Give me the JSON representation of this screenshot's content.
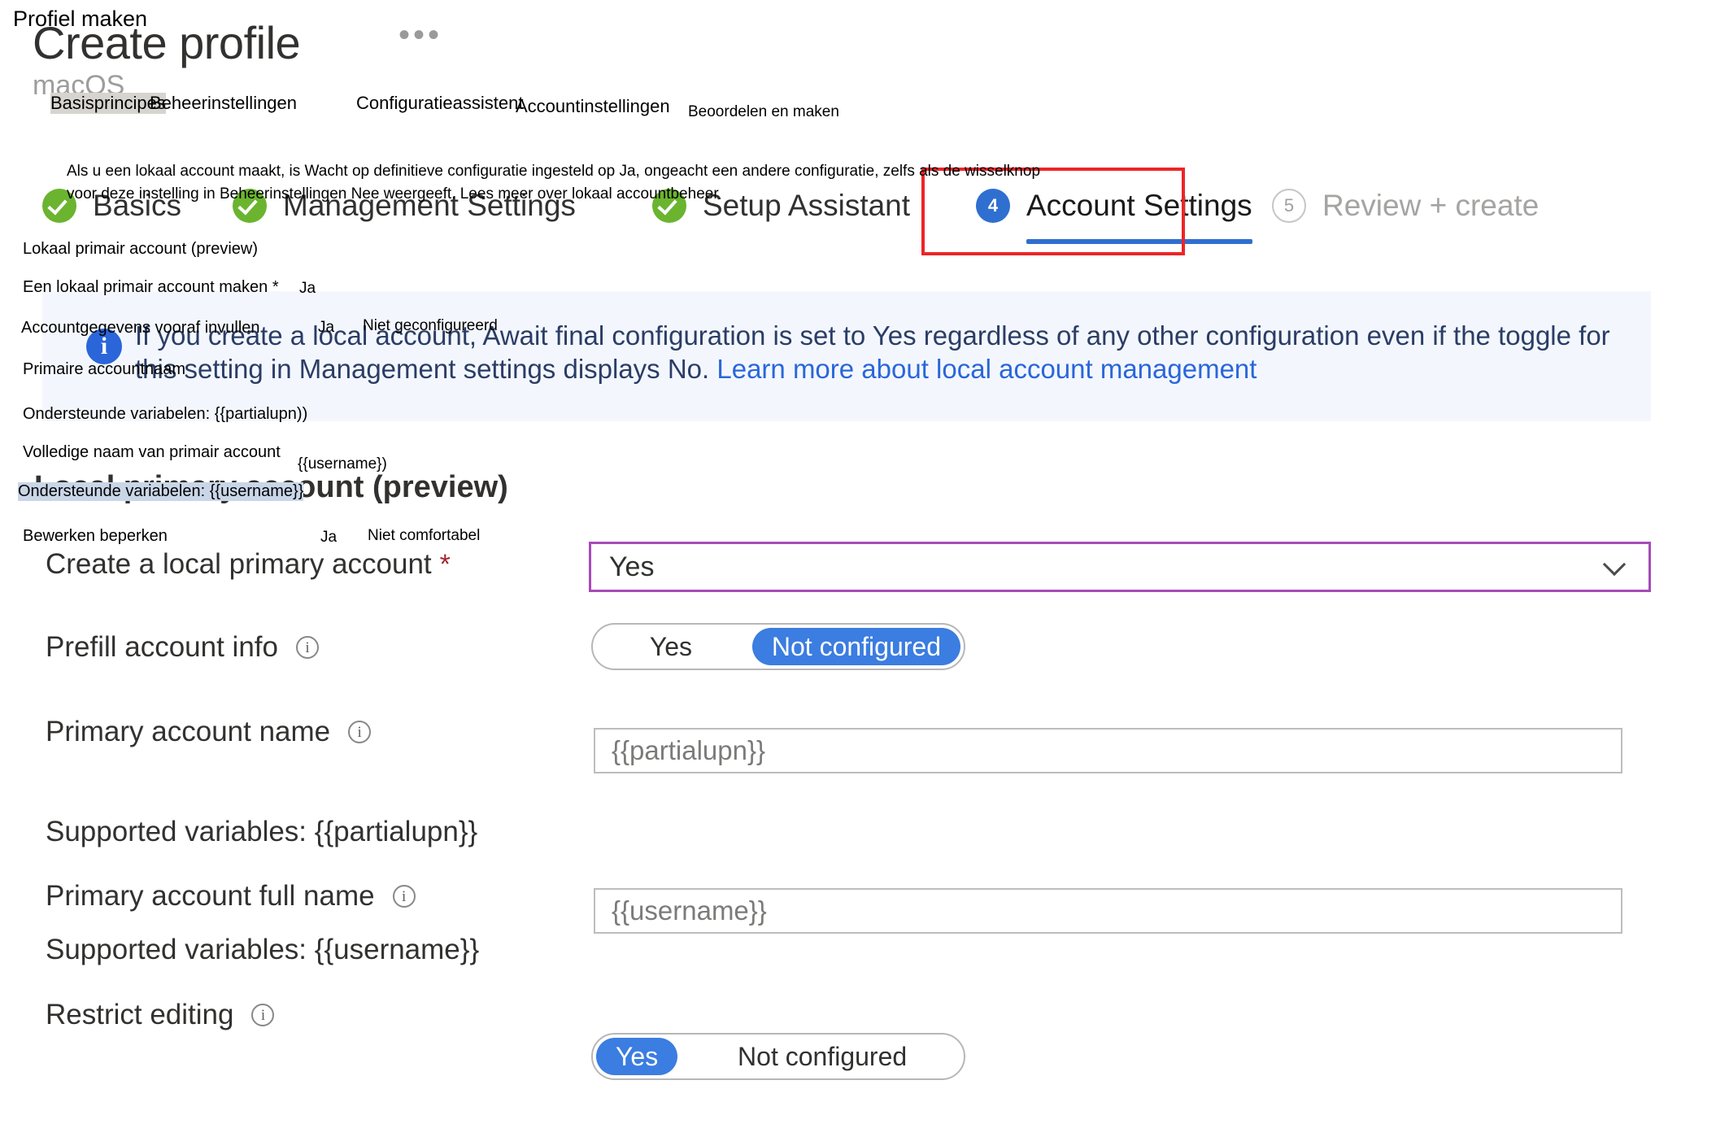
{
  "window": {
    "title": "Create profile",
    "subtitle": "macOS",
    "overflow_menu": "•••"
  },
  "wizard": {
    "steps": [
      {
        "num": "1",
        "label": "Basics",
        "state": "done"
      },
      {
        "num": "2",
        "label": "Management Settings",
        "state": "done"
      },
      {
        "num": "3",
        "label": "Setup Assistant",
        "state": "done"
      },
      {
        "num": "4",
        "label": "Account Settings",
        "state": "current"
      },
      {
        "num": "5",
        "label": "Review + create",
        "state": "pending"
      }
    ],
    "highlight_color": "#ec2527",
    "current_color": "#2f6fd0",
    "done_color": "#6bb42f"
  },
  "banner": {
    "icon": "info-icon",
    "line1": "If you create a local account, Await final configuration is set to Yes regardless of any other configuration even if the toggle for this",
    "line2_prefix": "setting in Management settings displays No. ",
    "line2_link": "Learn more about local account management",
    "background": "#f3f7fd",
    "link_color": "#2a66d9"
  },
  "section": {
    "heading": "Local primary account (preview)"
  },
  "form": {
    "create_local": {
      "label": "Create a local primary account",
      "required_marker": "*",
      "value": "Yes",
      "border_color": "#a64bb8"
    },
    "prefill": {
      "label": "Prefill account info",
      "option_yes": "Yes",
      "option_not_configured": "Not configured",
      "selected": "Not configured"
    },
    "primary_account_name": {
      "label": "Primary account name",
      "value": "{{partialupn}}",
      "note": "Supported variables: {{partialupn}}"
    },
    "primary_account_full_name": {
      "label": "Primary account full name",
      "value": "{{username}}",
      "note": "Supported variables: {{username}}"
    },
    "restrict_editing": {
      "label": "Restrict editing",
      "option_yes": "Yes",
      "option_not_configured": "Not configured",
      "selected": "Yes"
    }
  },
  "overlay": {
    "title": "Profiel maken",
    "tabs": [
      "Basisprincipes",
      "Beheerinstellingen",
      "Configuratieassistent",
      "Accountinstellingen",
      "Beoordelen en maken"
    ],
    "banner_line1": "Als u een lokaal account maakt, is Wacht op definitieve configuratie ingesteld op Ja, ongeacht een andere configuratie, zelfs als de wisselknop",
    "banner_line2": "voor deze instelling in Beheerinstellingen Nee weergeeft. Lees meer over lokaal accountbeheer",
    "section_heading": "Lokaal primair account (preview)",
    "row_create_local_label": "Een lokaal primair account maken *",
    "row_create_local_value": "Ja",
    "row_prefill_label": "Accountgegevens vooraf invullen",
    "row_prefill_yes": "Ja",
    "row_prefill_notconfig": "Niet geconfigureerd",
    "row_primary_name_label": "Primaire accountnaam",
    "row_primary_name_note": "Ondersteunde variabelen: {{partialupn))",
    "row_full_name_label": "Volledige naam van primair account",
    "row_full_name_value": "{{username})",
    "row_full_name_note": "Ondersteunde variabelen: {{username}}",
    "row_restrict_label": "Bewerken beperken",
    "row_restrict_yes": "Ja",
    "row_restrict_notconfig": "Niet comfortabel"
  }
}
